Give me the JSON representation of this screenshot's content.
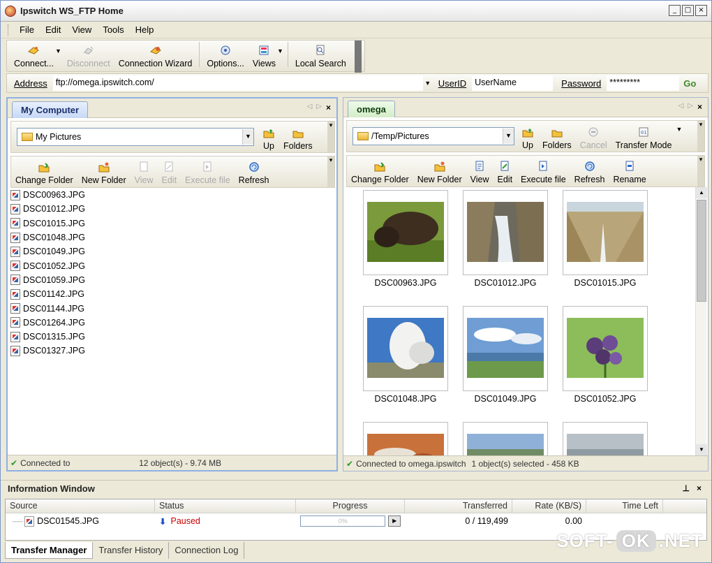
{
  "window": {
    "title": "Ipswitch WS_FTP Home",
    "min": "_",
    "max": "□",
    "close": "×"
  },
  "menu": [
    {
      "name": "menu-file",
      "label": "File"
    },
    {
      "name": "menu-edit",
      "label": "Edit"
    },
    {
      "name": "menu-view",
      "label": "View"
    },
    {
      "name": "menu-tools",
      "label": "Tools"
    },
    {
      "name": "menu-help",
      "label": "Help"
    }
  ],
  "toolbar": {
    "connect": "Connect...",
    "disconnect": "Disconnect",
    "wizard": "Connection Wizard",
    "options": "Options...",
    "views": "Views",
    "local_search": "Local Search"
  },
  "address": {
    "label": "Address",
    "value": "ftp://omega.ipswitch.com/",
    "userid_label": "UserID",
    "userid_value": "UserName",
    "password_label": "Password",
    "password_value": "*********",
    "go": "Go"
  },
  "left": {
    "tab": "My Computer",
    "folder": "My Pictures",
    "up": "Up",
    "folders": "Folders",
    "cmds": {
      "change_folder": "Change Folder",
      "new_folder": "New Folder",
      "view": "View",
      "edit": "Edit",
      "execute": "Execute file",
      "refresh": "Refresh"
    },
    "files": [
      "DSC00963.JPG",
      "DSC01012.JPG",
      "DSC01015.JPG",
      "DSC01048.JPG",
      "DSC01049.JPG",
      "DSC01052.JPG",
      "DSC01059.JPG",
      "DSC01142.JPG",
      "DSC01144.JPG",
      "DSC01264.JPG",
      "DSC01315.JPG",
      "DSC01327.JPG"
    ],
    "status_connected": "Connected to",
    "status_objects": "12 object(s) - 9.74 MB"
  },
  "right": {
    "tab": "omega",
    "folder": "/Temp/Pictures",
    "up": "Up",
    "folders": "Folders",
    "cancel": "Cancel",
    "transfer_mode": "Transfer Mode",
    "cmds": {
      "change_folder": "Change Folder",
      "new_folder": "New Folder",
      "view": "View",
      "edit": "Edit",
      "execute": "Execute file",
      "refresh": "Refresh",
      "rename": "Rename"
    },
    "thumbs": [
      "DSC00963.JPG",
      "DSC01012.JPG",
      "DSC01015.JPG",
      "DSC01048.JPG",
      "DSC01049.JPG",
      "DSC01052.JPG"
    ],
    "status_connected": "Connected to omega.ipswitch",
    "status_objects": "1 object(s) selected - 458 KB"
  },
  "info": {
    "title": "Information Window",
    "pin": "ᵖ",
    "close": "×",
    "cols": {
      "source": "Source",
      "status": "Status",
      "progress": "Progress",
      "transferred": "Transferred",
      "rate": "Rate (KB/S)",
      "time_left": "Time Left"
    },
    "row": {
      "source": "DSC01545.JPG",
      "status": "Paused",
      "progress": "0%",
      "transferred": "0 / 119,499",
      "rate": "0.00",
      "time_left": ""
    },
    "tabs": [
      "Transfer Manager",
      "Transfer History",
      "Connection Log"
    ]
  },
  "watermark": {
    "left": "SOFT-",
    "mid": "OK",
    "right": ".NET"
  },
  "colors": {
    "status_paused": "#cc0000",
    "connected_check": "#2b9b2b",
    "go": "#3a8a28"
  }
}
